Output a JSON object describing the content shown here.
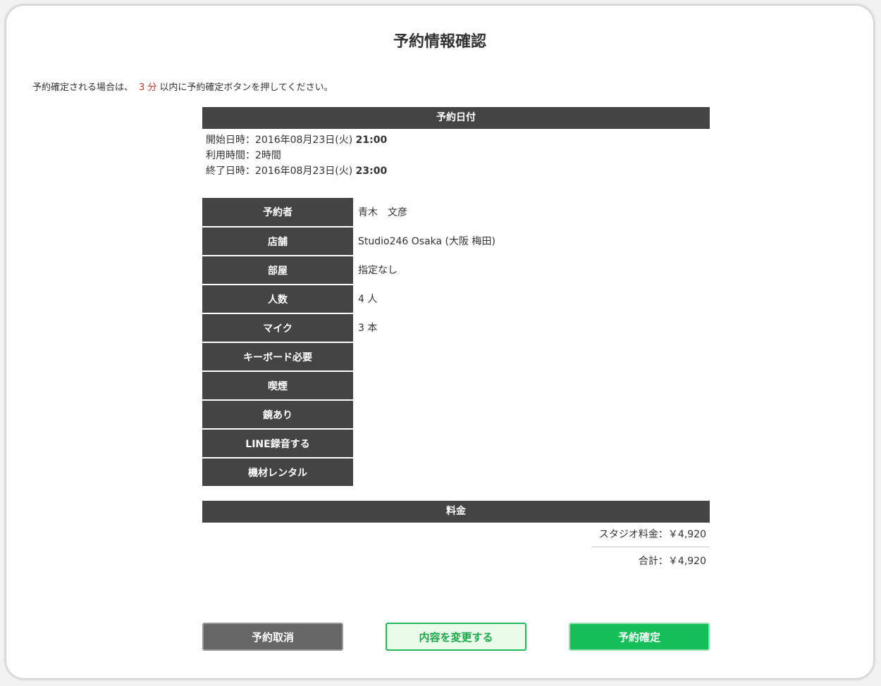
{
  "page": {
    "title": "予約情報確認",
    "notice_before": "予約確定される場合は、",
    "notice_minutes": "3 分",
    "notice_after": "以内に予約確定ボタンを押してください。"
  },
  "reservation_date": {
    "header": "予約日付",
    "start_label": "開始日時：2016年08月23日(火)",
    "start_time": "21:00",
    "duration": "利用時間：2時間",
    "end_label": "終了日時：2016年08月23日(火)",
    "end_time": "23:00"
  },
  "details": [
    {
      "label": "予約者",
      "value": "青木　文彦"
    },
    {
      "label": "店舗",
      "value": "Studio246 Osaka (大阪 梅田)"
    },
    {
      "label": "部屋",
      "value": "指定なし"
    },
    {
      "label": "人数",
      "value": "4 人"
    },
    {
      "label": "マイク",
      "value": "3 本"
    },
    {
      "label": "キーボード必要",
      "value": ""
    },
    {
      "label": "喫煙",
      "value": ""
    },
    {
      "label": "鏡あり",
      "value": ""
    },
    {
      "label": "LINE録音する",
      "value": ""
    },
    {
      "label": "機材レンタル",
      "value": ""
    }
  ],
  "price": {
    "header": "料金",
    "studio_fee": "スタジオ料金：￥4,920",
    "total": "合計：￥4,920"
  },
  "buttons": {
    "cancel": "予約取消",
    "change": "内容を変更する",
    "confirm": "予約確定"
  }
}
